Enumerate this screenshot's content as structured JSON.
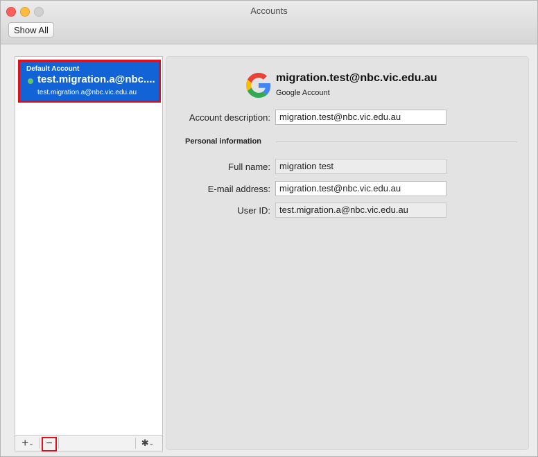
{
  "window": {
    "title": "Accounts",
    "show_all_label": "Show All"
  },
  "accounts": {
    "group_label": "Default Account",
    "items": [
      {
        "name": "test.migration.a@nbc....",
        "email": "test.migration.a@nbc.vic.edu.au",
        "status_color": "#62c46c"
      }
    ]
  },
  "footer": {
    "add_symbol": "+",
    "chevron_symbol": "⌄",
    "remove_symbol": "−",
    "gear_symbol": "✱"
  },
  "detail": {
    "header_email": "migration.test@nbc.vic.edu.au",
    "header_type": "Google Account",
    "account_description_label": "Account description:",
    "account_description_value": "migration.test@nbc.vic.edu.au",
    "personal_info_title": "Personal information",
    "full_name_label": "Full name:",
    "full_name_value": "migration test",
    "email_label": "E-mail address:",
    "email_value": "migration.test@nbc.vic.edu.au",
    "user_id_label": "User ID:",
    "user_id_value": "test.migration.a@nbc.vic.edu.au"
  },
  "colors": {
    "selection": "#1263d6",
    "highlight_border": "#e0101a"
  },
  "icons": {
    "provider_logo": "google-logo-icon"
  }
}
